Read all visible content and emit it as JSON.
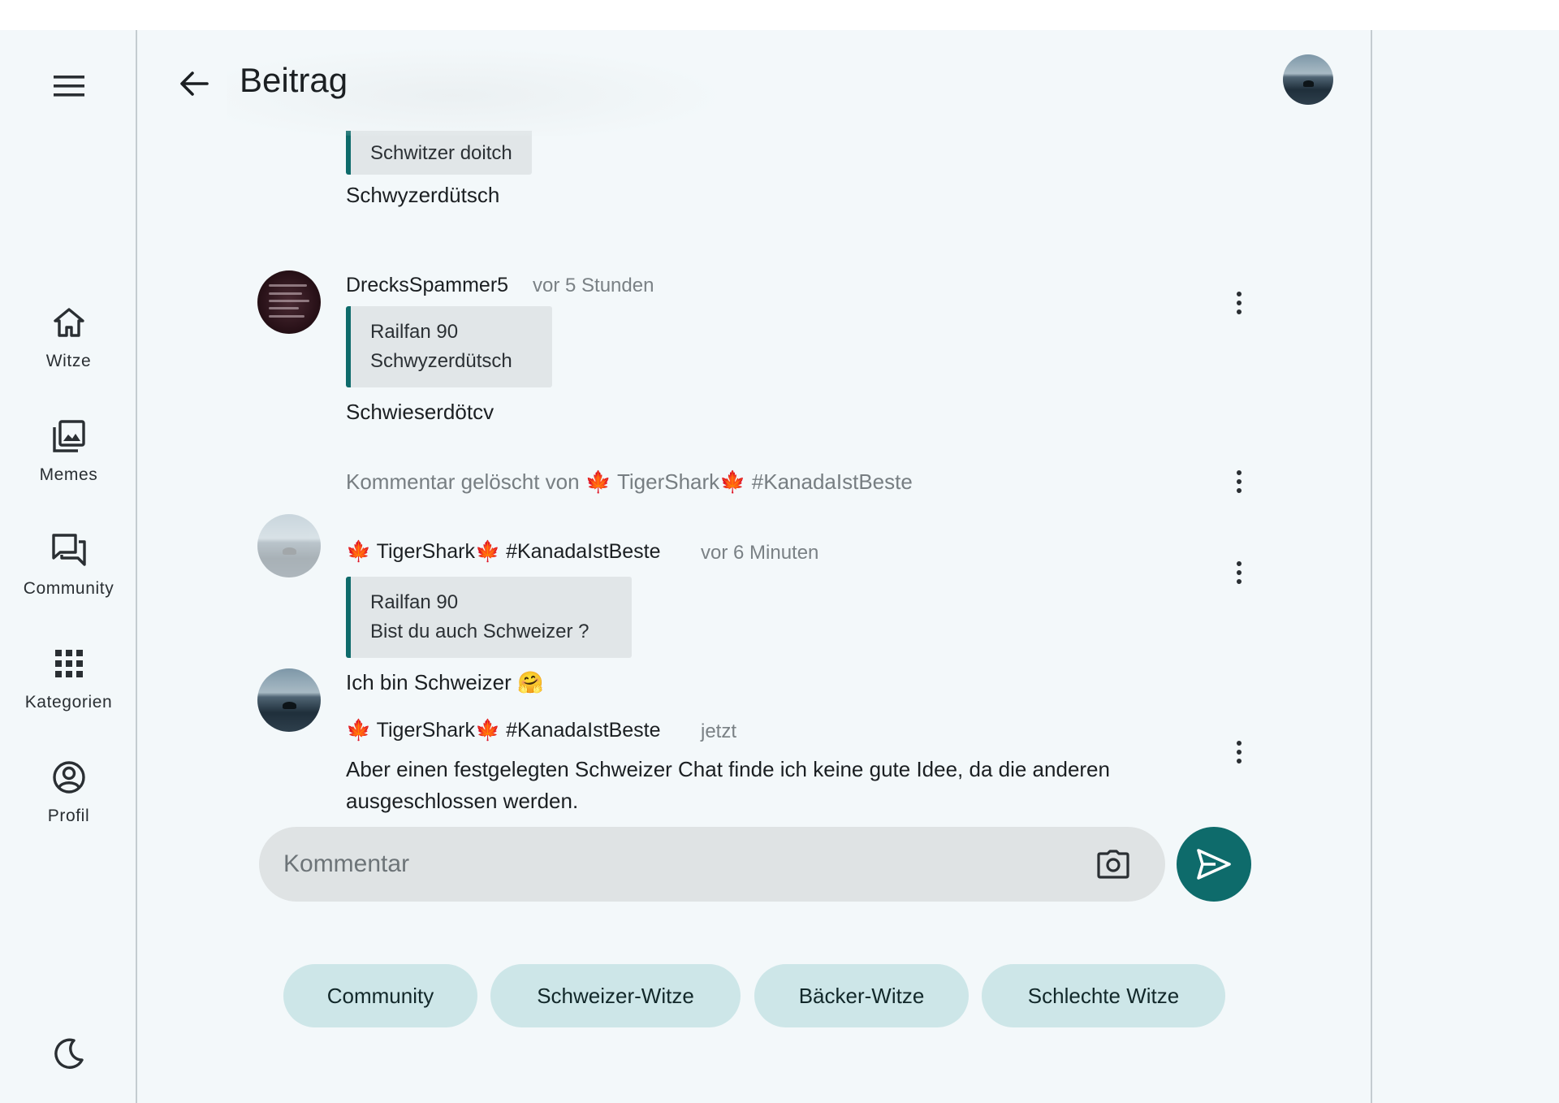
{
  "sidebar": {
    "items": [
      {
        "label": "Witze",
        "icon": "home-icon"
      },
      {
        "label": "Memes",
        "icon": "photo-library-icon"
      },
      {
        "label": "Community",
        "icon": "forum-icon"
      },
      {
        "label": "Kategorien",
        "icon": "apps-grid-icon"
      },
      {
        "label": "Profil",
        "icon": "account-circle-icon"
      }
    ],
    "theme_icon": "dark-mode-moon-icon"
  },
  "header": {
    "title": "Beitrag"
  },
  "comments": [
    {
      "quote_text": "Schwitzer doitch",
      "body": "Schwyzerdütsch"
    },
    {
      "author": "DrecksSpammer5",
      "time": "vor 5 Stunden",
      "quote_author": "Railfan 90",
      "quote_text": "Schwyzerdütsch",
      "body": "Schwieserdötcv"
    },
    {
      "deleted_prefix": "Kommentar gelöscht von",
      "deleted_name": "TigerShark",
      "deleted_tag": "#KanadaIstBeste"
    },
    {
      "author_name": "TigerShark",
      "author_tag": "#KanadaIstBeste",
      "time": "vor 6 Minuten",
      "quote_author": "Railfan 90",
      "quote_text": "Bist du auch Schweizer ?",
      "body": "Ich bin Schweizer 🤗"
    },
    {
      "author_name": "TigerShark",
      "author_tag": "#KanadaIstBeste",
      "time": "jetzt",
      "body": "Aber einen festgelegten Schweizer Chat finde ich keine gute Idee, da die anderen ausgeschlossen werden."
    }
  ],
  "leaf_emoji": "🍁",
  "comment_input": {
    "placeholder": "Kommentar"
  },
  "categories": [
    "Community",
    "Schweizer-Witze",
    "Bäcker-Witze",
    "Schlechte Witze"
  ],
  "colors": {
    "accent": "#0e6b6b",
    "background": "#f3f8fa",
    "chip": "#cde6e8",
    "quote_bg": "#e1e6e8"
  }
}
